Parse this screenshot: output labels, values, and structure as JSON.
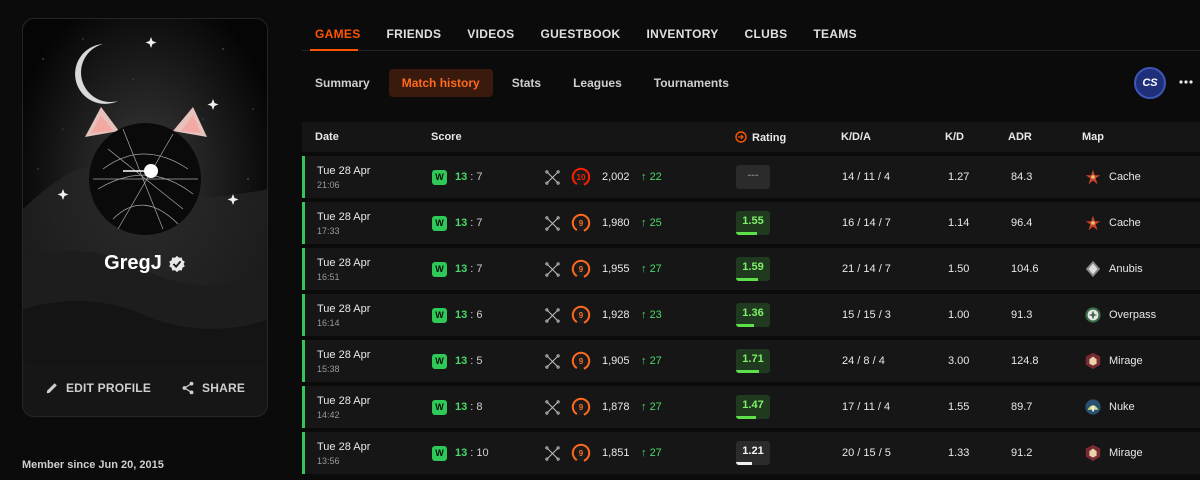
{
  "profile": {
    "username": "GregJ",
    "edit_label": "EDIT PROFILE",
    "share_label": "SHARE",
    "member_since": "Member since Jun 20, 2015"
  },
  "nav": {
    "items": [
      "GAMES",
      "FRIENDS",
      "VIDEOS",
      "GUESTBOOK",
      "INVENTORY",
      "CLUBS",
      "TEAMS"
    ],
    "active": "GAMES"
  },
  "sub_tabs": {
    "items": [
      "Summary",
      "Match history",
      "Stats",
      "Leagues",
      "Tournaments"
    ],
    "active": "Match history"
  },
  "game_badge": "CS",
  "table": {
    "headers": {
      "date": "Date",
      "score": "Score",
      "rating": "Rating",
      "kda": "K/D/A",
      "kd": "K/D",
      "adr": "ADR",
      "map": "Map"
    },
    "rows": [
      {
        "date": "Tue 28 Apr",
        "time": "21:06",
        "result": "W",
        "score_won": "13",
        "score_lost": "7",
        "level": "10",
        "elo": "2,002",
        "elo_change": "22",
        "rating": "---",
        "rating_style": "empty",
        "rating_value": 0,
        "kda": "14 / 11 / 4",
        "kd": "1.27",
        "adr": "84.3",
        "map": "Cache",
        "map_icon": "cache-map-icon"
      },
      {
        "date": "Tue 28 Apr",
        "time": "17:33",
        "result": "W",
        "score_won": "13",
        "score_lost": "7",
        "level": "9",
        "elo": "1,980",
        "elo_change": "25",
        "rating": "1.55",
        "rating_style": "green",
        "rating_value": 1.55,
        "kda": "16 / 14 / 7",
        "kd": "1.14",
        "adr": "96.4",
        "map": "Cache",
        "map_icon": "cache-map-icon"
      },
      {
        "date": "Tue 28 Apr",
        "time": "16:51",
        "result": "W",
        "score_won": "13",
        "score_lost": "7",
        "level": "9",
        "elo": "1,955",
        "elo_change": "27",
        "rating": "1.59",
        "rating_style": "green",
        "rating_value": 1.59,
        "kda": "21 / 14 / 7",
        "kd": "1.50",
        "adr": "104.6",
        "map": "Anubis",
        "map_icon": "anubis-map-icon"
      },
      {
        "date": "Tue 28 Apr",
        "time": "16:14",
        "result": "W",
        "score_won": "13",
        "score_lost": "6",
        "level": "9",
        "elo": "1,928",
        "elo_change": "23",
        "rating": "1.36",
        "rating_style": "green",
        "rating_value": 1.36,
        "kda": "15 / 15 / 3",
        "kd": "1.00",
        "adr": "91.3",
        "map": "Overpass",
        "map_icon": "overpass-map-icon"
      },
      {
        "date": "Tue 28 Apr",
        "time": "15:38",
        "result": "W",
        "score_won": "13",
        "score_lost": "5",
        "level": "9",
        "elo": "1,905",
        "elo_change": "27",
        "rating": "1.71",
        "rating_style": "green",
        "rating_value": 1.71,
        "kda": "24 / 8 / 4",
        "kd": "3.00",
        "adr": "124.8",
        "map": "Mirage",
        "map_icon": "mirage-map-icon"
      },
      {
        "date": "Tue 28 Apr",
        "time": "14:42",
        "result": "W",
        "score_won": "13",
        "score_lost": "8",
        "level": "9",
        "elo": "1,878",
        "elo_change": "27",
        "rating": "1.47",
        "rating_style": "green",
        "rating_value": 1.47,
        "kda": "17 / 11 / 4",
        "kd": "1.55",
        "adr": "89.7",
        "map": "Nuke",
        "map_icon": "nuke-map-icon"
      },
      {
        "date": "Tue 28 Apr",
        "time": "13:56",
        "result": "W",
        "score_won": "13",
        "score_lost": "10",
        "level": "9",
        "elo": "1,851",
        "elo_change": "27",
        "rating": "1.21",
        "rating_style": "white",
        "rating_value": 1.21,
        "kda": "20 / 15 / 5",
        "kd": "1.33",
        "adr": "91.2",
        "map": "Mirage",
        "map_icon": "mirage-map-icon"
      }
    ]
  },
  "colors": {
    "accent": "#ff5500",
    "win": "#2fc957",
    "level_ring": "#ff6a1f",
    "level_10_ring": "#fe1f00"
  }
}
